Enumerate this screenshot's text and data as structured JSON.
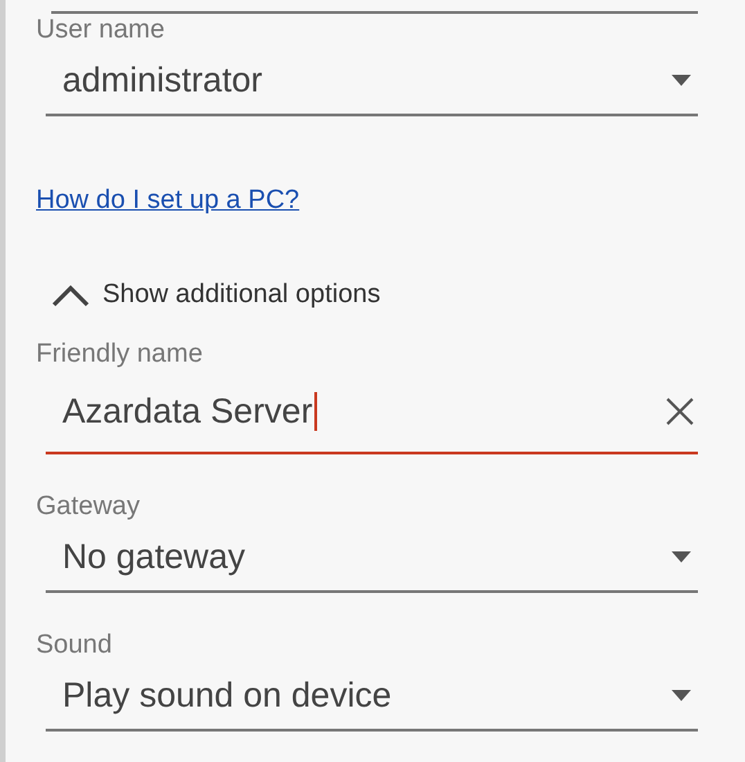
{
  "user_field": {
    "kind": "dropdown",
    "label": "User name",
    "value": "administrator"
  },
  "help_link": "How do I set up a PC?",
  "additional_options": {
    "label": "Show additional options",
    "expanded": true
  },
  "extra_fields": [
    {
      "kind": "text",
      "label": "Friendly name",
      "value": "Azardata Server",
      "focused": true
    },
    {
      "kind": "dropdown",
      "label": "Gateway",
      "value": "No gateway",
      "focused": false
    },
    {
      "kind": "dropdown",
      "label": "Sound",
      "value": "Play sound on device",
      "focused": false
    }
  ]
}
